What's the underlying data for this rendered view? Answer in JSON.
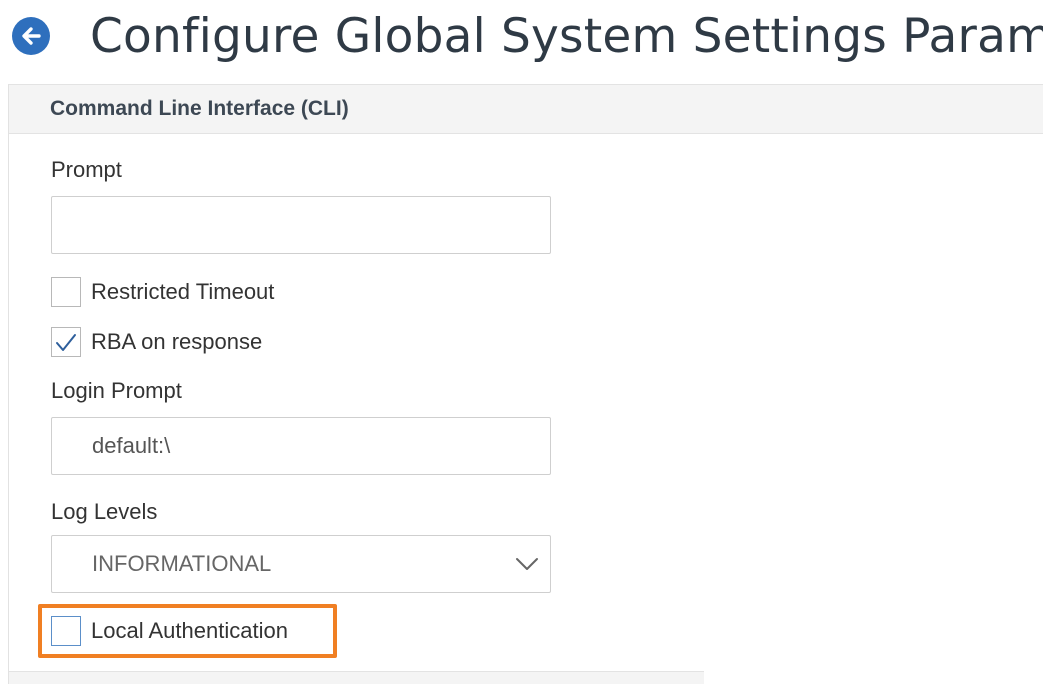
{
  "header": {
    "title": "Configure Global System Settings Param",
    "back_icon": "arrow-left-icon",
    "accent_color": "#2e6fbd"
  },
  "section": {
    "title": "Command Line Interface (CLI)"
  },
  "fields": {
    "prompt": {
      "label": "Prompt",
      "value": ""
    },
    "restricted_timeout": {
      "label": "Restricted Timeout",
      "checked": false
    },
    "rba_on_response": {
      "label": "RBA on response",
      "checked": true
    },
    "login_prompt": {
      "label": "Login Prompt",
      "value": "default:\\"
    },
    "log_levels": {
      "label": "Log Levels",
      "selected": "INFORMATIONAL"
    },
    "local_authentication": {
      "label": "Local Authentication",
      "checked": false,
      "highlight_color": "#f07f23"
    }
  }
}
